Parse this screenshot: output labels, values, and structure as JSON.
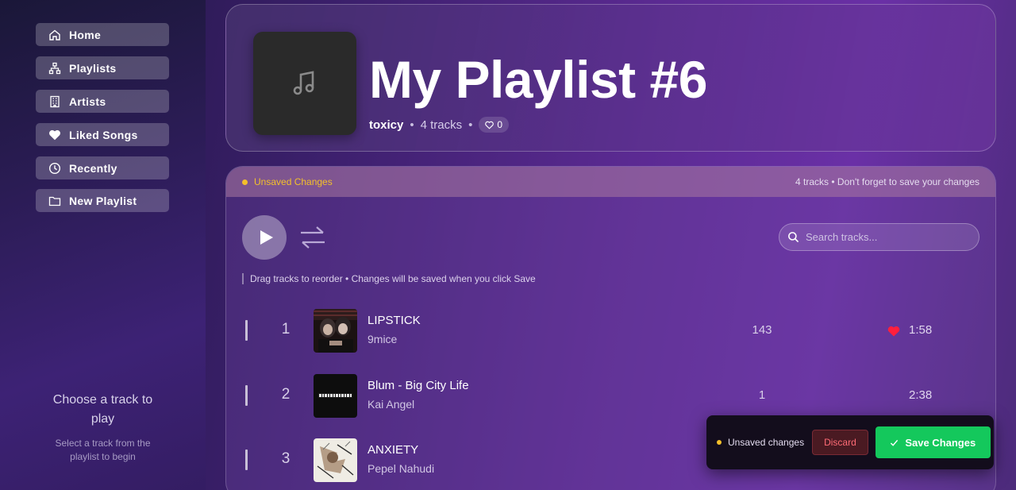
{
  "sidebar": {
    "items": [
      {
        "label": "Home",
        "icon": "home-icon"
      },
      {
        "label": "Playlists",
        "icon": "sitemap-icon"
      },
      {
        "label": "Artists",
        "icon": "building-icon"
      },
      {
        "label": "Liked Songs",
        "icon": "heart-icon"
      },
      {
        "label": "Recently",
        "icon": "clock-icon"
      },
      {
        "label": "New Playlist",
        "icon": "folder-icon"
      }
    ],
    "empty_title": "Choose a track to play",
    "empty_subtitle": "Select a track from the playlist to begin"
  },
  "playlist": {
    "title": "My Playlist #6",
    "owner": "toxicy",
    "separator": "•",
    "track_count": "4 tracks",
    "likes": "0"
  },
  "unsaved_bar": {
    "status": "Unsaved Changes",
    "info": "4 tracks • Don't forget to save your changes"
  },
  "controls": {
    "search_placeholder": "Search tracks...",
    "hint": "Drag tracks to reorder • Changes will be saved when you click Save"
  },
  "tracks": [
    {
      "num": "1",
      "title": "LIPSTICK",
      "artist": "9mice",
      "plays": "143",
      "liked": true,
      "duration": "1:58"
    },
    {
      "num": "2",
      "title": "Blum - Big City Life",
      "artist": "Kai Angel",
      "plays": "1",
      "liked": false,
      "duration": "2:38"
    },
    {
      "num": "3",
      "title": "ANXIETY",
      "artist": "Pepel Nahudi",
      "plays": "",
      "liked": false,
      "duration": ""
    }
  ],
  "save_bar": {
    "status": "Unsaved changes",
    "discard_label": "Discard",
    "save_label": "Save Changes"
  },
  "colors": {
    "accent_green": "#14c85c",
    "warning_yellow": "#f4c02a",
    "heart_red": "#ff1f3d",
    "discard_red": "#ff6b75"
  }
}
